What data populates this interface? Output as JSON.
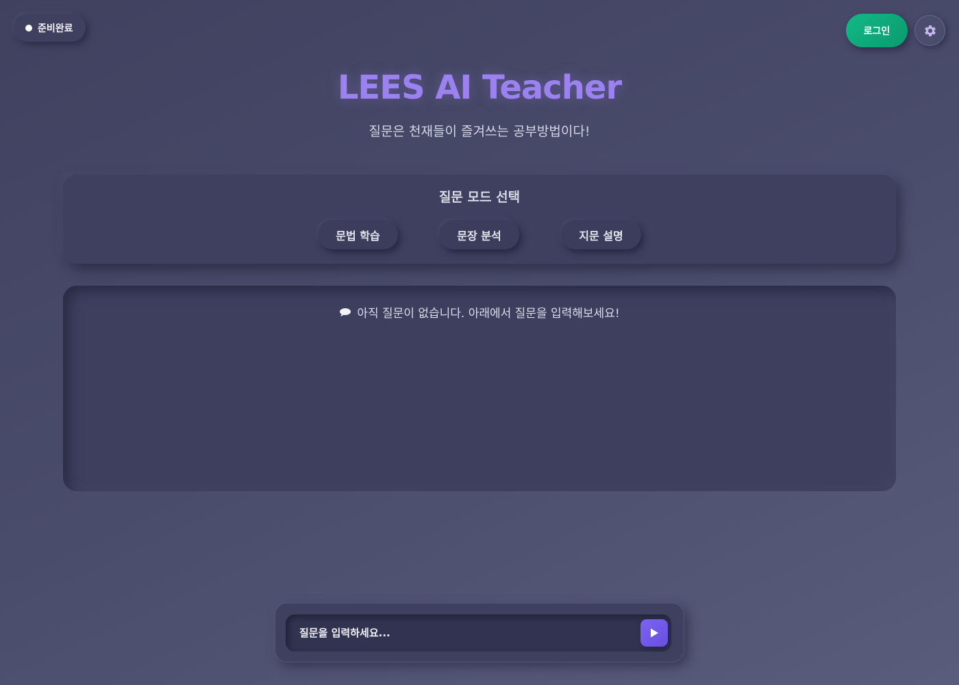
{
  "status": {
    "label": "준비완료"
  },
  "header": {
    "login_label": "로그인",
    "settings_icon": "gear-icon",
    "title": "LEES AI Teacher",
    "subtitle": "질문은 천재들이 즐겨쓰는 공부방법이다!"
  },
  "mode_panel": {
    "heading": "질문 모드 선택",
    "modes": [
      {
        "label": "문법 학습"
      },
      {
        "label": "문장 분석"
      },
      {
        "label": "지문 설명"
      }
    ]
  },
  "chat": {
    "empty_icon": "speech-bubble-icon",
    "empty_message": "아직 질문이 없습니다. 아래에서 질문을 입력해보세요!"
  },
  "input": {
    "placeholder": "질문을 입력하세요...",
    "value": "",
    "send_icon": "play-icon"
  },
  "colors": {
    "accent": "#9b82f0",
    "login": "#12b886",
    "send": "#7c63f2",
    "background": "#4a4c6c"
  }
}
